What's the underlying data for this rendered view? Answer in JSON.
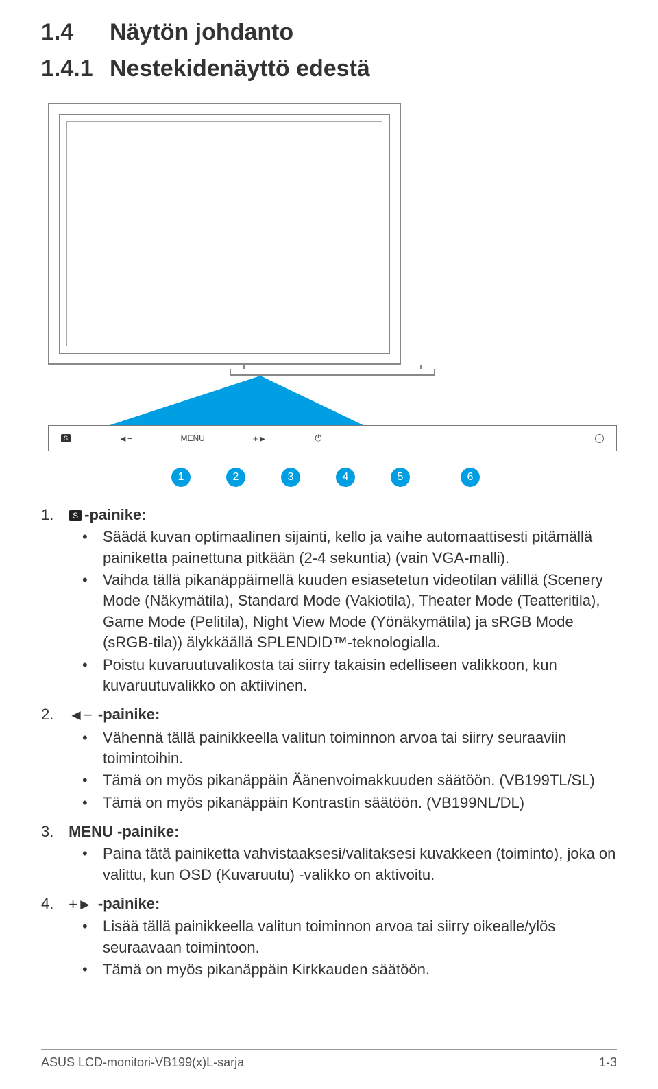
{
  "headings": {
    "h1_num": "1.4",
    "h1_text": "Näytön johdanto",
    "h2_num": "1.4.1",
    "h2_text": "Nestekidenäyttö edestä"
  },
  "panel": {
    "s_label": "S",
    "menu_label": "MENU"
  },
  "badges": [
    "1",
    "2",
    "3",
    "4",
    "5",
    "6"
  ],
  "items": [
    {
      "no": "1.",
      "icon_text": "S",
      "title_suffix": "-painike:",
      "bullets": [
        "Säädä kuvan optimaalinen sijainti, kello ja vaihe automaattisesti pitämällä painiketta painettuna pitkään (2-4 sekuntia) (vain VGA-malli).",
        "Vaihda tällä pikanäppäimellä kuuden esiasetetun videotilan välillä (Scenery Mode (Näkymätila), Standard Mode (Vakiotila), Theater Mode (Teatteritila), Game Mode (Pelitila), Night View Mode (Yönäkymätila) ja sRGB Mode (sRGB-tila)) älykkäällä SPLENDID™-teknologialla.",
        "Poistu kuvaruutuvalikosta tai siirry takaisin edelliseen valikkoon, kun kuvaruutuvalikko on aktiivinen."
      ]
    },
    {
      "no": "2.",
      "arrow": "◄−",
      "title_suffix": " -painike:",
      "bullets": [
        "Vähennä tällä painikkeella valitun toiminnon arvoa tai siirry seuraaviin toimintoihin.",
        "Tämä on myös pikanäppäin Äänenvoimakkuuden säätöön. (VB199TL/SL)",
        "Tämä on myös pikanäppäin Kontrastin säätöön. (VB199NL/DL)"
      ]
    },
    {
      "no": "3.",
      "plain_title": "MENU -painike:",
      "bullets": [
        "Paina tätä painiketta vahvistaaksesi/valitaksesi kuvakkeen (toiminto), joka on valittu, kun OSD (Kuvaruutu) -valikko on aktivoitu."
      ]
    },
    {
      "no": "4.",
      "arrow": "+►",
      "title_suffix": " -painike:",
      "bullets": [
        "Lisää tällä painikkeella valitun toiminnon arvoa tai siirry oikealle/ylös seuraavaan toimintoon.",
        "Tämä on myös pikanäppäin Kirkkauden säätöön."
      ]
    }
  ],
  "footer": {
    "left": "ASUS LCD-monitori-VB199(x)L-sarja",
    "right": "1-3"
  }
}
